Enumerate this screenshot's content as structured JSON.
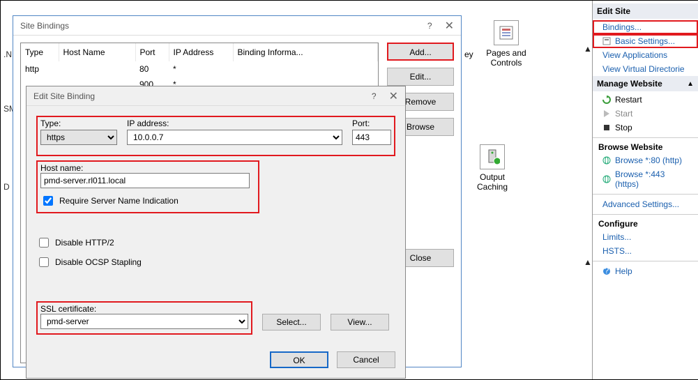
{
  "fragments": {
    "n": ".N",
    "sm": "SM",
    "d": "D"
  },
  "bgIcons": {
    "pages": "Pages and Controls",
    "output": "Output Caching",
    "ey": "ey"
  },
  "right": {
    "editSite": "Edit Site",
    "bindings": "Bindings...",
    "basic": "Basic Settings...",
    "viewApps": "View Applications",
    "viewVDir": "View Virtual Directorie",
    "manage": "Manage Website",
    "restart": "Restart",
    "start": "Start",
    "stop": "Stop",
    "browse": "Browse Website",
    "browse80": "Browse *:80 (http)",
    "browse443": "Browse *:443 (https)",
    "adv": "Advanced Settings...",
    "configure": "Configure",
    "limits": "Limits...",
    "hsts": "HSTS...",
    "help": "Help"
  },
  "sb": {
    "title": "Site Bindings",
    "cols": {
      "type": "Type",
      "host": "Host Name",
      "port": "Port",
      "ip": "IP Address",
      "info": "Binding Informa..."
    },
    "row1": {
      "type": "http",
      "host": "",
      "port": "80",
      "ip": "*",
      "info": ""
    },
    "row2": {
      "port": "900",
      "ip": "*"
    },
    "btns": {
      "add": "Add...",
      "edit": "Edit...",
      "remove": "Remove",
      "browse": "Browse",
      "close": "Close"
    }
  },
  "eb": {
    "title": "Edit Site Binding",
    "typeLabel": "Type:",
    "typeValue": "https",
    "ipLabel": "IP address:",
    "ipValue": "10.0.0.7",
    "portLabel": "Port:",
    "portValue": "443",
    "hostLabel": "Host name:",
    "hostValue": "pmd-server.rl011.local",
    "sni": "Require Server Name Indication",
    "disH2": "Disable HTTP/2",
    "disOCSP": "Disable OCSP Stapling",
    "sslLabel": "SSL certificate:",
    "sslValue": "pmd-server",
    "select": "Select...",
    "view": "View...",
    "ok": "OK",
    "cancel": "Cancel"
  }
}
